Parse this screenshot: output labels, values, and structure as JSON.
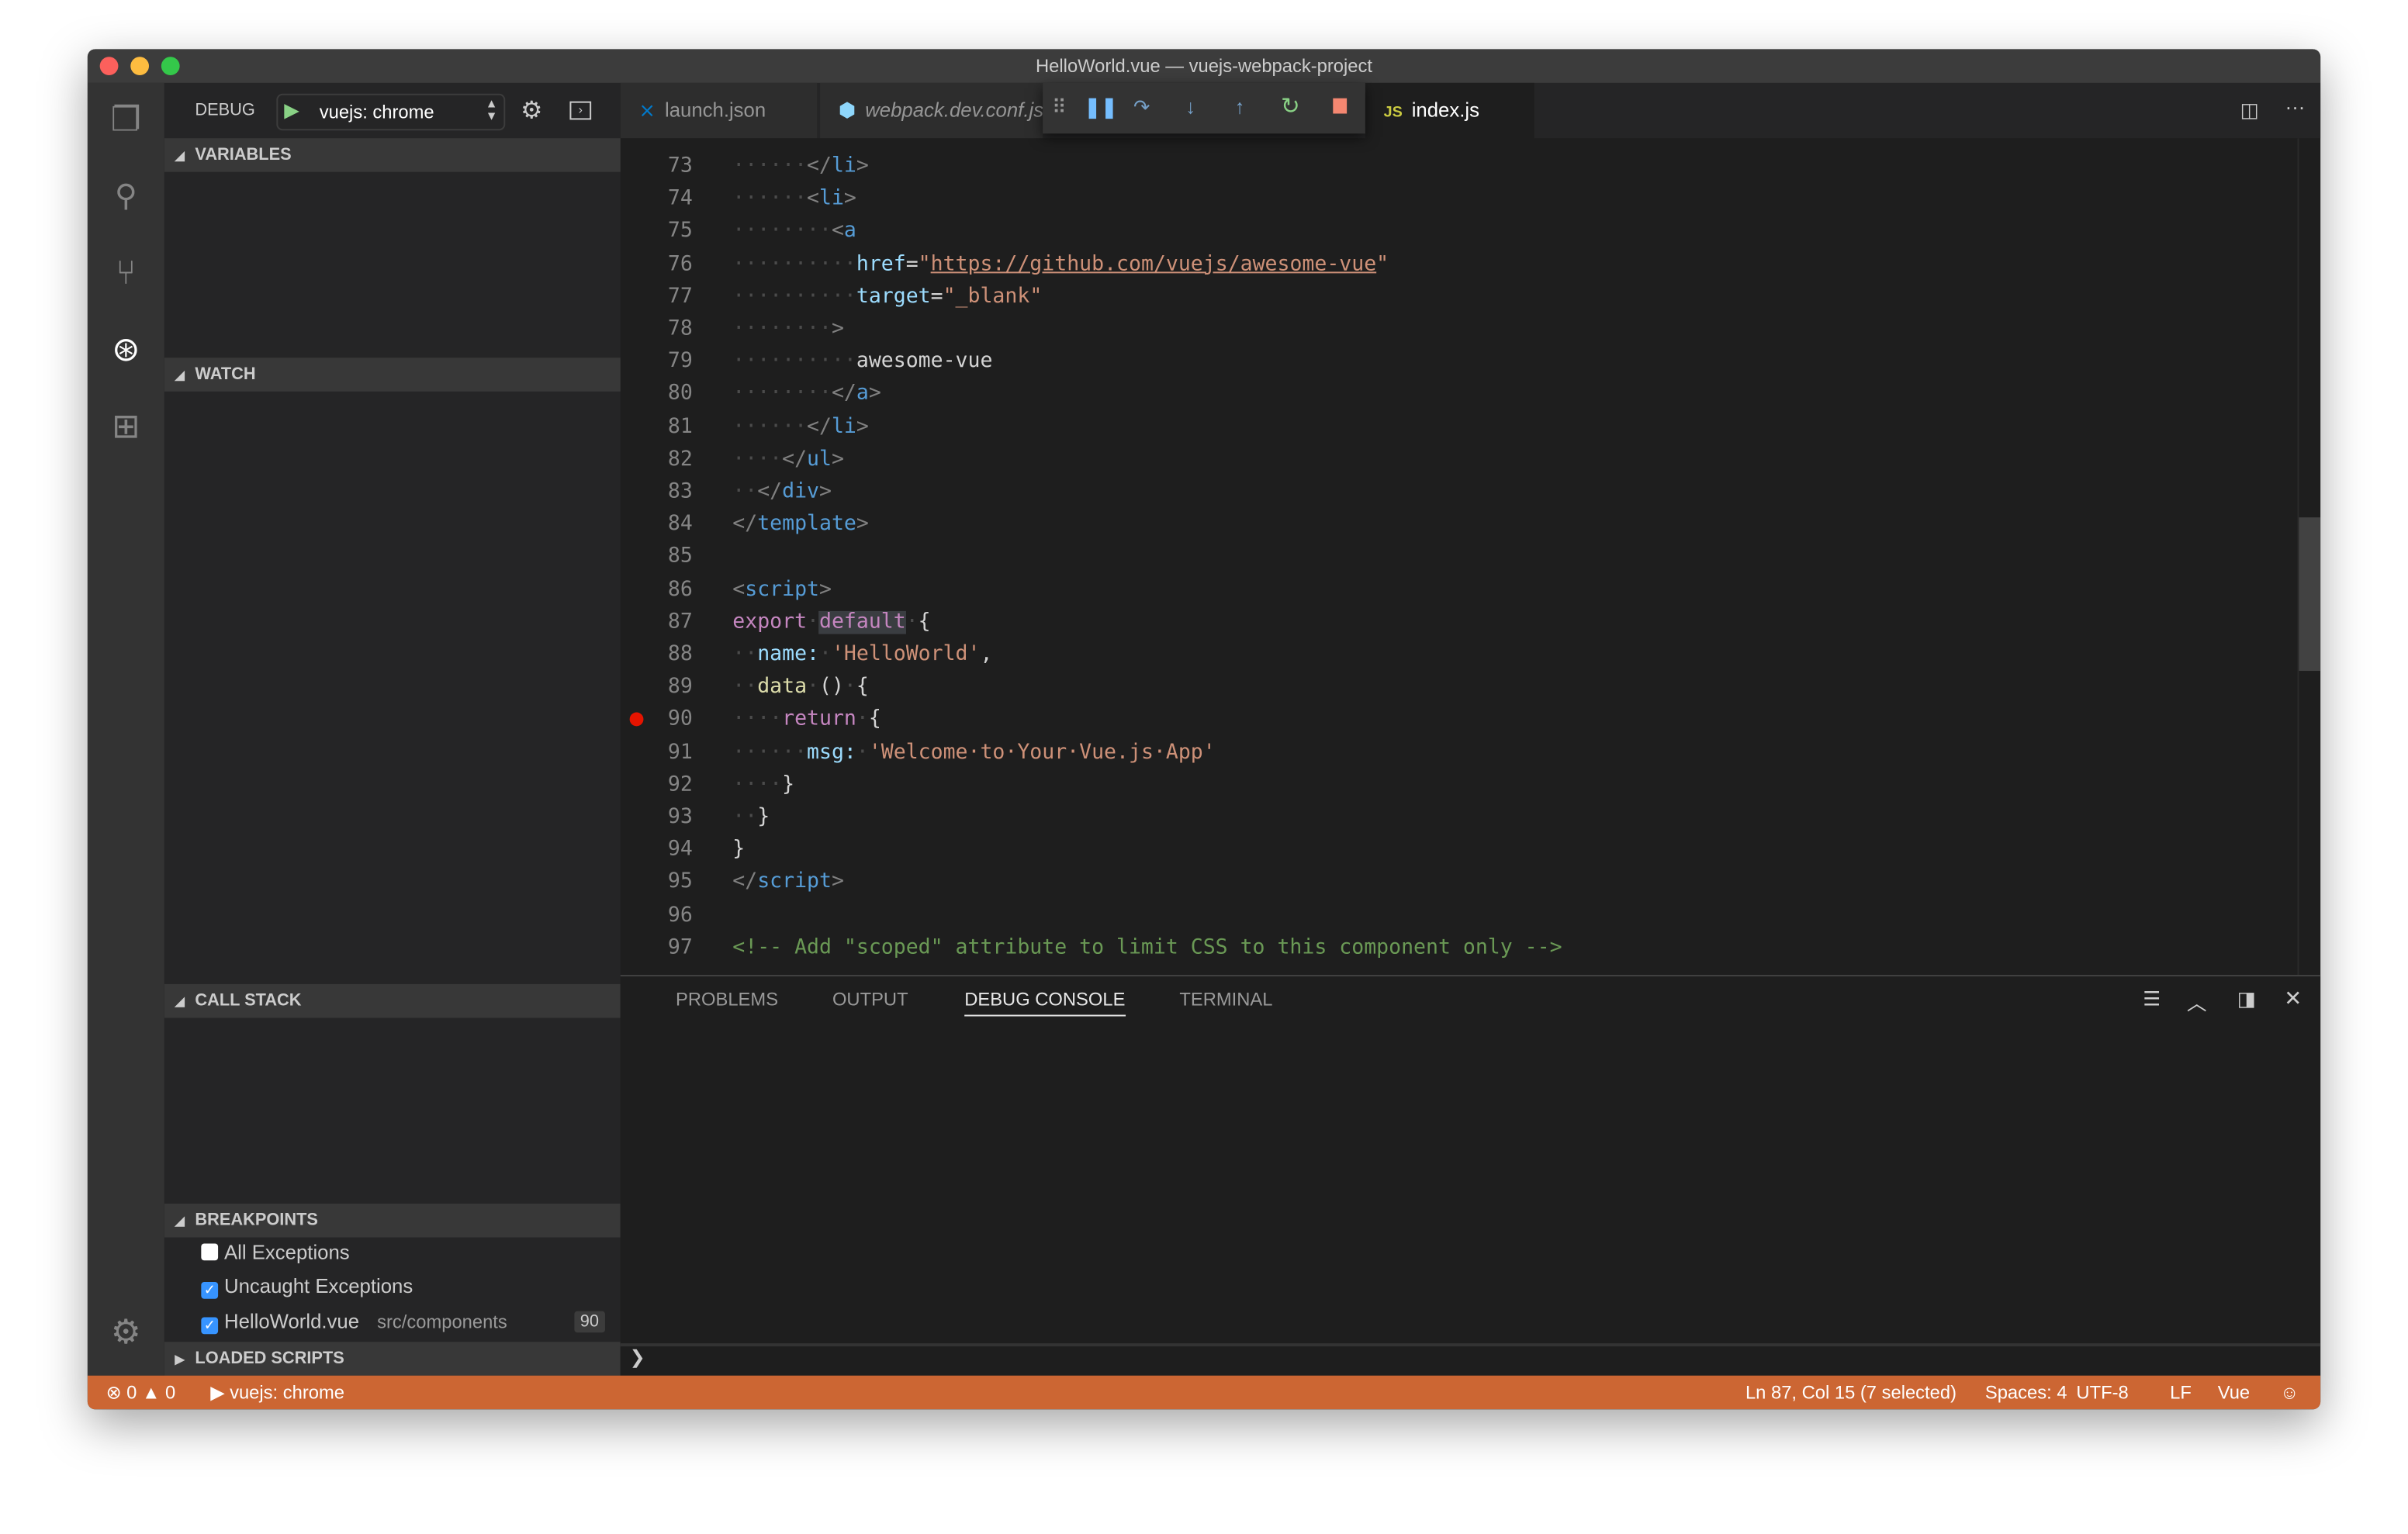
{
  "window": {
    "title": "HelloWorld.vue — vuejs-webpack-project"
  },
  "colors": {
    "status_bar": "#cc6633",
    "accent": "#3794ff",
    "breakpoint": "#e51400"
  },
  "activity_bar": [
    {
      "icon": "files-icon"
    },
    {
      "icon": "search-icon"
    },
    {
      "icon": "source-control-icon"
    },
    {
      "icon": "debug-icon"
    },
    {
      "icon": "extensions-icon"
    },
    {
      "icon": "gear-icon"
    }
  ],
  "debug": {
    "label": "DEBUG",
    "configuration": "vuejs: chrome"
  },
  "sections": {
    "variables": "VARIABLES",
    "watch": "WATCH",
    "call_stack": "CALL STACK",
    "breakpoints": "BREAKPOINTS",
    "loaded_scripts": "LOADED SCRIPTS"
  },
  "breakpoints": [
    {
      "label": "All Exceptions",
      "checked": false
    },
    {
      "label": "Uncaught Exceptions",
      "checked": true
    },
    {
      "label": "HelloWorld.vue",
      "path": "src/components",
      "line": "90",
      "checked": true
    }
  ],
  "tabs": [
    {
      "label": "launch.json",
      "icon": "vscode-icon"
    },
    {
      "label": "webpack.dev.conf.js",
      "icon": "webpack-icon"
    },
    {
      "label": "index.js",
      "icon": "js-icon",
      "badge": "JS"
    }
  ],
  "debug_toolbar": [
    "drag-handle",
    "pause",
    "step-over",
    "step-into",
    "step-out",
    "restart",
    "stop"
  ],
  "code": [
    {
      "n": "73",
      "indent": 6,
      "t": [
        [
          "</",
          "p"
        ],
        [
          "li",
          "g"
        ],
        [
          ">",
          "p"
        ]
      ]
    },
    {
      "n": "74",
      "indent": 6,
      "t": [
        [
          "<",
          "p"
        ],
        [
          "li",
          "g"
        ],
        [
          ">",
          "p"
        ]
      ]
    },
    {
      "n": "75",
      "indent": 8,
      "t": [
        [
          "<",
          "p"
        ],
        [
          "a",
          "g"
        ]
      ]
    },
    {
      "n": "76",
      "indent": 10,
      "t": [
        [
          "href",
          "a"
        ],
        [
          "=",
          "w"
        ],
        [
          "\"",
          "s"
        ],
        [
          "https://github.com/vuejs/awesome-vue",
          "u"
        ],
        [
          "\"",
          "s"
        ]
      ]
    },
    {
      "n": "77",
      "indent": 10,
      "t": [
        [
          "target",
          "a"
        ],
        [
          "=",
          "w"
        ],
        [
          "\"_blank\"",
          "s"
        ]
      ]
    },
    {
      "n": "78",
      "indent": 8,
      "t": [
        [
          ">",
          "p"
        ]
      ]
    },
    {
      "n": "79",
      "indent": 10,
      "t": [
        [
          "awesome-vue",
          "w"
        ]
      ]
    },
    {
      "n": "80",
      "indent": 8,
      "t": [
        [
          "</",
          "p"
        ],
        [
          "a",
          "g"
        ],
        [
          ">",
          "p"
        ]
      ]
    },
    {
      "n": "81",
      "indent": 6,
      "t": [
        [
          "</",
          "p"
        ],
        [
          "li",
          "g"
        ],
        [
          ">",
          "p"
        ]
      ]
    },
    {
      "n": "82",
      "indent": 4,
      "t": [
        [
          "</",
          "p"
        ],
        [
          "ul",
          "g"
        ],
        [
          ">",
          "p"
        ]
      ]
    },
    {
      "n": "83",
      "indent": 2,
      "t": [
        [
          "</",
          "p"
        ],
        [
          "div",
          "g"
        ],
        [
          ">",
          "p"
        ]
      ]
    },
    {
      "n": "84",
      "indent": 0,
      "t": [
        [
          "</",
          "p"
        ],
        [
          "template",
          "g"
        ],
        [
          ">",
          "p"
        ]
      ]
    },
    {
      "n": "85",
      "indent": 0,
      "t": []
    },
    {
      "n": "86",
      "indent": 0,
      "t": [
        [
          "<",
          "p"
        ],
        [
          "script",
          "g"
        ],
        [
          ">",
          "p"
        ]
      ]
    },
    {
      "n": "87",
      "indent": 0,
      "t": [
        [
          "export",
          "k"
        ],
        [
          "·",
          "x"
        ],
        [
          "default",
          "h"
        ],
        [
          "·",
          "x"
        ],
        [
          "{",
          "w"
        ]
      ]
    },
    {
      "n": "88",
      "indent": 2,
      "t": [
        [
          "name:",
          "a"
        ],
        [
          "·",
          "x"
        ],
        [
          "'HelloWorld'",
          "s"
        ],
        [
          ",",
          "w"
        ]
      ]
    },
    {
      "n": "89",
      "indent": 2,
      "t": [
        [
          "data",
          "f"
        ],
        [
          "·",
          "x"
        ],
        [
          "()",
          "w"
        ],
        [
          "·",
          "x"
        ],
        [
          "{",
          "w"
        ]
      ]
    },
    {
      "n": "90",
      "indent": 4,
      "t": [
        [
          "return",
          "k"
        ],
        [
          "·",
          "x"
        ],
        [
          "{",
          "w"
        ]
      ],
      "breakpoint": true
    },
    {
      "n": "91",
      "indent": 6,
      "t": [
        [
          "msg:",
          "a"
        ],
        [
          "·",
          "x"
        ],
        [
          "'Welcome·to·Your·Vue.js·App'",
          "s"
        ]
      ]
    },
    {
      "n": "92",
      "indent": 4,
      "t": [
        [
          "}",
          "w"
        ]
      ]
    },
    {
      "n": "93",
      "indent": 2,
      "t": [
        [
          "}",
          "w"
        ]
      ]
    },
    {
      "n": "94",
      "indent": 0,
      "t": [
        [
          "}",
          "w"
        ]
      ]
    },
    {
      "n": "95",
      "indent": 0,
      "t": [
        [
          "</",
          "p"
        ],
        [
          "script",
          "g"
        ],
        [
          ">",
          "p"
        ]
      ]
    },
    {
      "n": "96",
      "indent": 0,
      "t": []
    },
    {
      "n": "97",
      "indent": 0,
      "t": [
        [
          "<!-- Add \"scoped\" attribute to limit CSS to this component only -->",
          "c"
        ]
      ]
    }
  ],
  "panel": {
    "tabs": [
      "PROBLEMS",
      "OUTPUT",
      "DEBUG CONSOLE",
      "TERMINAL"
    ],
    "active": "DEBUG CONSOLE",
    "prompt": "❯"
  },
  "status": {
    "errors": "0",
    "warnings": "0",
    "debug_config": "vuejs: chrome",
    "position": "Ln 87, Col 15 (7 selected)",
    "spaces": "Spaces: 4",
    "encoding": "UTF-8",
    "eol": "LF",
    "language": "Vue"
  }
}
